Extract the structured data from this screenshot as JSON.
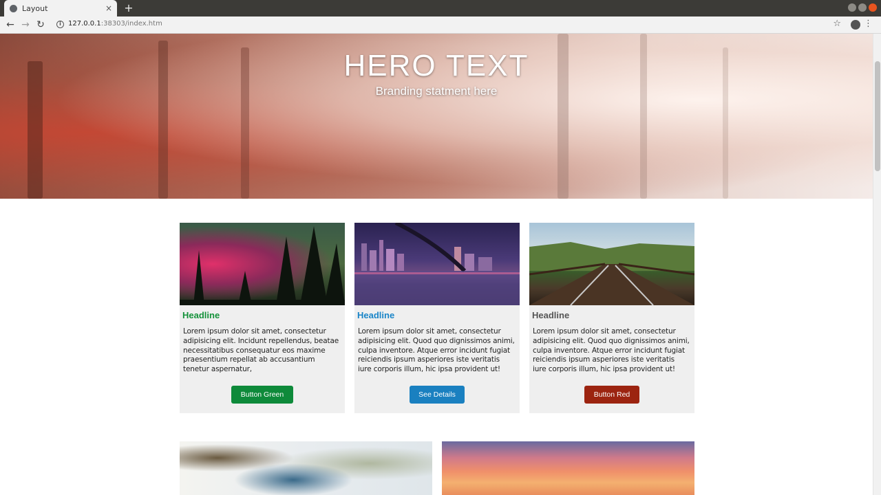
{
  "browser": {
    "tab_title": "Layout",
    "tab_close": "×",
    "new_tab": "+",
    "url_host": "127.0.0.1",
    "url_path": ":38303/index.htm"
  },
  "hero": {
    "title": "HERO TEXT",
    "subtitle": "Branding statment here"
  },
  "cards": [
    {
      "headline": "Headline",
      "headline_color": "#14913a",
      "body": "Lorem ipsum dolor sit amet, consectetur adipisicing elit. Incidunt repellendus, beatae necessitatibus consequatur eos maxime praesentium repellat ab accusantium tenetur aspernatur,",
      "button_label": "Button Green",
      "button_color": "#0e8a3a",
      "image": "aurora-forest"
    },
    {
      "headline": "Headline",
      "headline_color": "#1a85c8",
      "body": "Lorem ipsum dolor sit amet, consectetur adipisicing elit. Quod quo dignissimos animi, culpa inventore. Atque error incidunt fugiat reiciendis ipsum asperiores iste veritatis iure corporis illum, hic ipsa provident ut!",
      "button_label": "See Details",
      "button_color": "#1a80c0",
      "image": "city-bridge-night"
    },
    {
      "headline": "Headline",
      "headline_color": "#555555",
      "body": "Lorem ipsum dolor sit amet, consectetur adipisicing elit. Quod quo dignissimos animi, culpa inventore. Atque error incidunt fugiat reiciendis ipsum asperiores iste veritatis iure corporis illum, hic ipsa provident ut!",
      "button_label": "Button Red",
      "button_color": "#9c2410",
      "image": "railway-bridge"
    }
  ],
  "bottom_images": [
    "blurred-bokeh",
    "sunset-sky"
  ]
}
